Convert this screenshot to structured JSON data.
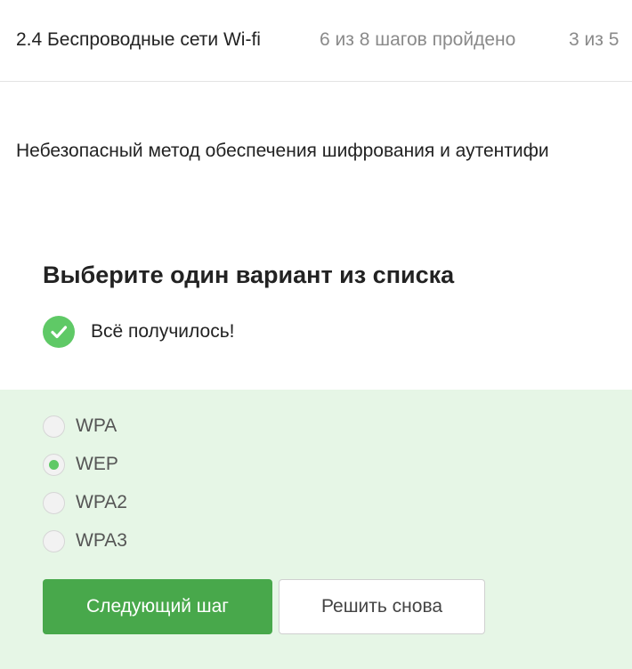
{
  "header": {
    "lesson_title": "2.4 Беспроводные сети Wi-fi",
    "steps_progress": "6 из 8 шагов пройдено",
    "step_counter": "3 из 5"
  },
  "question": {
    "text": "Небезопасный метод обеспечения шифрования и аутентифи"
  },
  "quiz": {
    "heading": "Выберите один вариант из списка",
    "result_text": "Всё получилось!",
    "result_icon": "check-circle-icon",
    "accent_color": "#5fc966",
    "options": [
      {
        "label": "WPA",
        "selected": false
      },
      {
        "label": "WEP",
        "selected": true
      },
      {
        "label": "WPA2",
        "selected": false
      },
      {
        "label": "WPA3",
        "selected": false
      }
    ],
    "next_button_label": "Следующий шаг",
    "retry_button_label": "Решить снова"
  }
}
